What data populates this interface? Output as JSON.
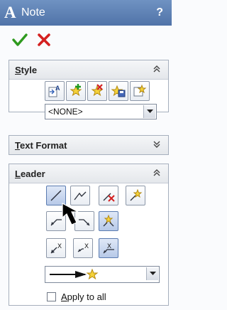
{
  "title_bar": {
    "app_icon_letter": "A",
    "title": "Note",
    "help_label": "?"
  },
  "actions": {
    "ok_icon": "green-check-icon",
    "cancel_icon": "red-x-icon"
  },
  "style_panel": {
    "title": "Style",
    "toolbar_icons": [
      "apply-style-icon",
      "add-style-icon",
      "delete-style-icon",
      "save-style-icon",
      "load-style-icon"
    ],
    "style_dropdown": {
      "value": "<NONE>"
    }
  },
  "text_format_panel": {
    "title": "Text Format",
    "collapsed": true
  },
  "leader_panel": {
    "title": "Leader",
    "buttons_row1": [
      "straight-leader-icon",
      "bent-leader-icon",
      "no-leader-icon",
      "auto-leader-icon"
    ],
    "buttons_row2": [
      "leader-left-icon",
      "leader-right-icon",
      "leader-nearest-icon"
    ],
    "buttons_row3": [
      "leader-to-face-icon",
      "leader-to-edge-icon",
      "leader-under-icon"
    ],
    "arrow_style": {
      "value": "arrow-to-star"
    },
    "apply_to_all": {
      "label": "Apply to all",
      "checked": false
    }
  },
  "colors": {
    "title_bar": "#5a7db3",
    "accent_blue": "#5a7bb0",
    "ok_green": "#2e9a1e",
    "cancel_red": "#d42020"
  }
}
